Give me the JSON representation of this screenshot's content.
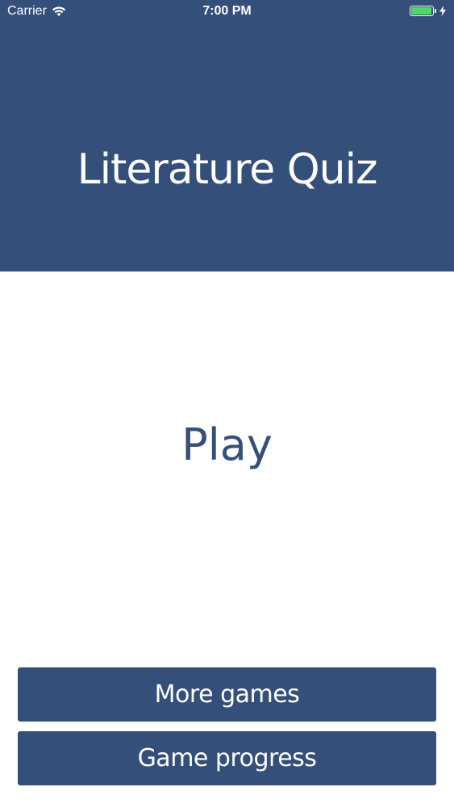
{
  "status_bar": {
    "carrier": "Carrier",
    "time": "7:00 PM",
    "battery_level": 1.0,
    "battery_color": "#4cd964",
    "icons": [
      "wifi-icon",
      "battery-icon",
      "charging-bolt-icon"
    ]
  },
  "header": {
    "title": "Literature Quiz",
    "background_color": "#344f7a"
  },
  "main": {
    "play_label": "Play"
  },
  "menu": {
    "more_games_label": "More games",
    "game_progress_label": "Game progress"
  },
  "colors": {
    "accent": "#344f7a",
    "background": "#ffffff",
    "text_on_accent": "#ffffff"
  }
}
